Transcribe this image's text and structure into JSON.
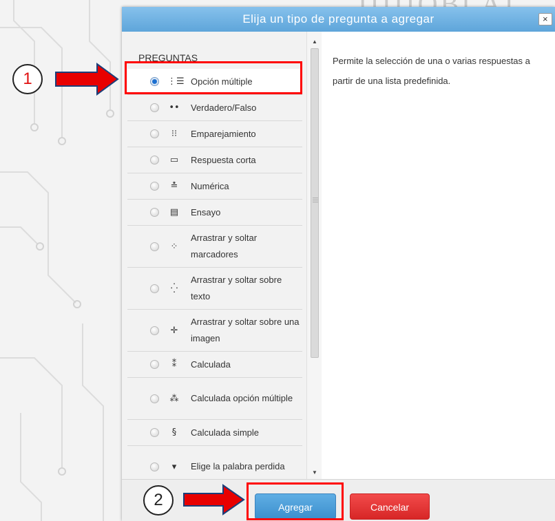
{
  "dialog": {
    "title": "Elija un tipo de pregunta a agregar",
    "close_label": "×"
  },
  "question_list": {
    "heading": "PREGUNTAS",
    "items": [
      {
        "label": "Opción múltiple",
        "icon": "multichoice-icon",
        "glyph": "⋮☰",
        "selected": true
      },
      {
        "label": "Verdadero/Falso",
        "icon": "truefalse-icon",
        "glyph": "••",
        "selected": false
      },
      {
        "label": "Emparejamiento",
        "icon": "matching-icon",
        "glyph": "⁝⁝",
        "selected": false
      },
      {
        "label": "Respuesta corta",
        "icon": "shortanswer-icon",
        "glyph": "▭",
        "selected": false
      },
      {
        "label": "Numérica",
        "icon": "numerical-icon",
        "glyph": "≛",
        "selected": false
      },
      {
        "label": "Ensayo",
        "icon": "essay-icon",
        "glyph": "▤",
        "selected": false
      },
      {
        "label": "Arrastrar y soltar marcadores",
        "icon": "drag-markers-icon",
        "glyph": "⁘",
        "selected": false
      },
      {
        "label": "Arrastrar y soltar sobre texto",
        "icon": "drag-text-icon",
        "glyph": "⁛",
        "selected": false
      },
      {
        "label": "Arrastrar y soltar sobre una imagen",
        "icon": "drag-image-icon",
        "glyph": "✛",
        "selected": false
      },
      {
        "label": "Calculada",
        "icon": "calculated-icon",
        "glyph": "⁑",
        "selected": false
      },
      {
        "label": "Calculada opción múltiple",
        "icon": "calculated-multi-icon",
        "glyph": "⁂",
        "selected": false
      },
      {
        "label": "Calculada simple",
        "icon": "calculated-simple-icon",
        "glyph": "§",
        "selected": false
      },
      {
        "label": "Elige la palabra perdida",
        "icon": "missing-word-icon",
        "glyph": "▾",
        "selected": false
      }
    ]
  },
  "description": "Permite la selección de una o varias respuestas a partir de una lista predefinida.",
  "footer": {
    "add_label": "Agregar",
    "cancel_label": "Cancelar"
  },
  "annotations": {
    "step_1": "1",
    "step_2": "2"
  },
  "colors": {
    "titlebar": "#6fb2e3",
    "add_button": "#4a9ad6",
    "cancel_button": "#e33535",
    "highlight": "#ff0000"
  }
}
